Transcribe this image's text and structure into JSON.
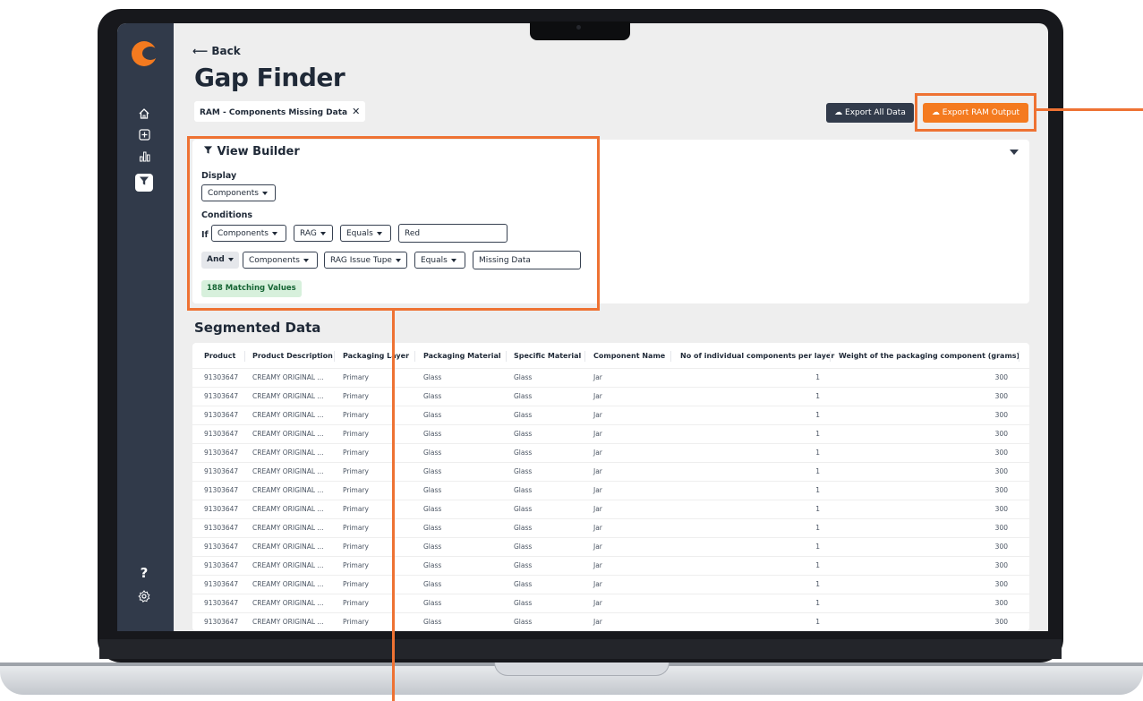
{
  "app": {
    "back_label": "Back",
    "title": "Gap Finder",
    "filter_chip": "RAM - Components Missing Data",
    "filter_chip_close": "✕",
    "export_all_label": "Export All Data",
    "export_ram_label": "Export RAM Output",
    "accent_color": "#f47a1f",
    "sidebar_color": "#313a4a"
  },
  "sidebar": {
    "icons": [
      "home-icon",
      "add-icon",
      "chart-icon",
      "filter-icon",
      "help-icon",
      "settings-icon"
    ],
    "help_glyph": "?",
    "active": "filter-icon"
  },
  "view_builder": {
    "title": "View Builder",
    "display_label": "Display",
    "display_value": "Components",
    "conditions_label": "Conditions",
    "if_label": "If",
    "cond1": {
      "entity": "Components",
      "field": "RAG",
      "operator": "Equals",
      "value": "Red"
    },
    "and_label": "And",
    "cond2": {
      "entity": "Components",
      "field": "RAG Issue Tupe",
      "operator": "Equals",
      "value": "Missing Data"
    },
    "match_text": "188 Matching Values"
  },
  "segmented": {
    "title": "Segmented Data",
    "columns": [
      "Product",
      "Product Description",
      "Packaging Layer",
      "Packaging Material",
      "Specific Material",
      "Component Name",
      "No of individual components per layer",
      "Weight of the packaging component (grams)"
    ],
    "rows": [
      [
        "91303647",
        "CREAMY ORIGINAL ...",
        "Primary",
        "Glass",
        "Glass",
        "Jar",
        "1",
        "300"
      ],
      [
        "91303647",
        "CREAMY ORIGINAL ...",
        "Primary",
        "Glass",
        "Glass",
        "Jar",
        "1",
        "300"
      ],
      [
        "91303647",
        "CREAMY ORIGINAL ...",
        "Primary",
        "Glass",
        "Glass",
        "Jar",
        "1",
        "300"
      ],
      [
        "91303647",
        "CREAMY ORIGINAL ...",
        "Primary",
        "Glass",
        "Glass",
        "Jar",
        "1",
        "300"
      ],
      [
        "91303647",
        "CREAMY ORIGINAL ...",
        "Primary",
        "Glass",
        "Glass",
        "Jar",
        "1",
        "300"
      ],
      [
        "91303647",
        "CREAMY ORIGINAL ...",
        "Primary",
        "Glass",
        "Glass",
        "Jar",
        "1",
        "300"
      ],
      [
        "91303647",
        "CREAMY ORIGINAL ...",
        "Primary",
        "Glass",
        "Glass",
        "Jar",
        "1",
        "300"
      ],
      [
        "91303647",
        "CREAMY ORIGINAL ...",
        "Primary",
        "Glass",
        "Glass",
        "Jar",
        "1",
        "300"
      ],
      [
        "91303647",
        "CREAMY ORIGINAL ...",
        "Primary",
        "Glass",
        "Glass",
        "Jar",
        "1",
        "300"
      ],
      [
        "91303647",
        "CREAMY ORIGINAL ...",
        "Primary",
        "Glass",
        "Glass",
        "Jar",
        "1",
        "300"
      ],
      [
        "91303647",
        "CREAMY ORIGINAL ...",
        "Primary",
        "Glass",
        "Glass",
        "Jar",
        "1",
        "300"
      ],
      [
        "91303647",
        "CREAMY ORIGINAL ...",
        "Primary",
        "Glass",
        "Glass",
        "Jar",
        "1",
        "300"
      ],
      [
        "91303647",
        "CREAMY ORIGINAL ...",
        "Primary",
        "Glass",
        "Glass",
        "Jar",
        "1",
        "300"
      ],
      [
        "91303647",
        "CREAMY ORIGINAL ...",
        "Primary",
        "Glass",
        "Glass",
        "Jar",
        "1",
        "300"
      ]
    ]
  }
}
